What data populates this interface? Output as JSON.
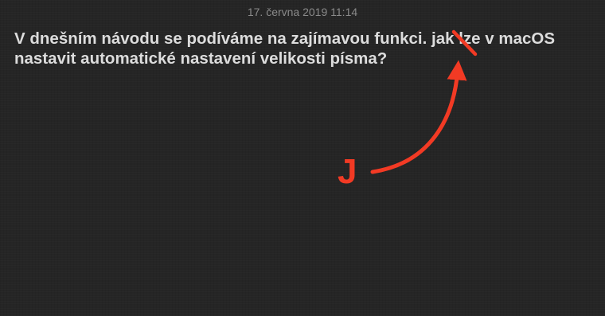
{
  "note": {
    "timestamp": "17. června 2019 11:14",
    "body": "V dnešním návodu se podíváme na zajímavou funkci. jak lze v macOS nastavit automatické nastavení velikosti písma?"
  },
  "annotation": {
    "letter": "J",
    "color": "#f23a24"
  },
  "colors": {
    "background": "#252525",
    "text": "#dcdcdc",
    "timestamp": "#8a8a8a"
  }
}
